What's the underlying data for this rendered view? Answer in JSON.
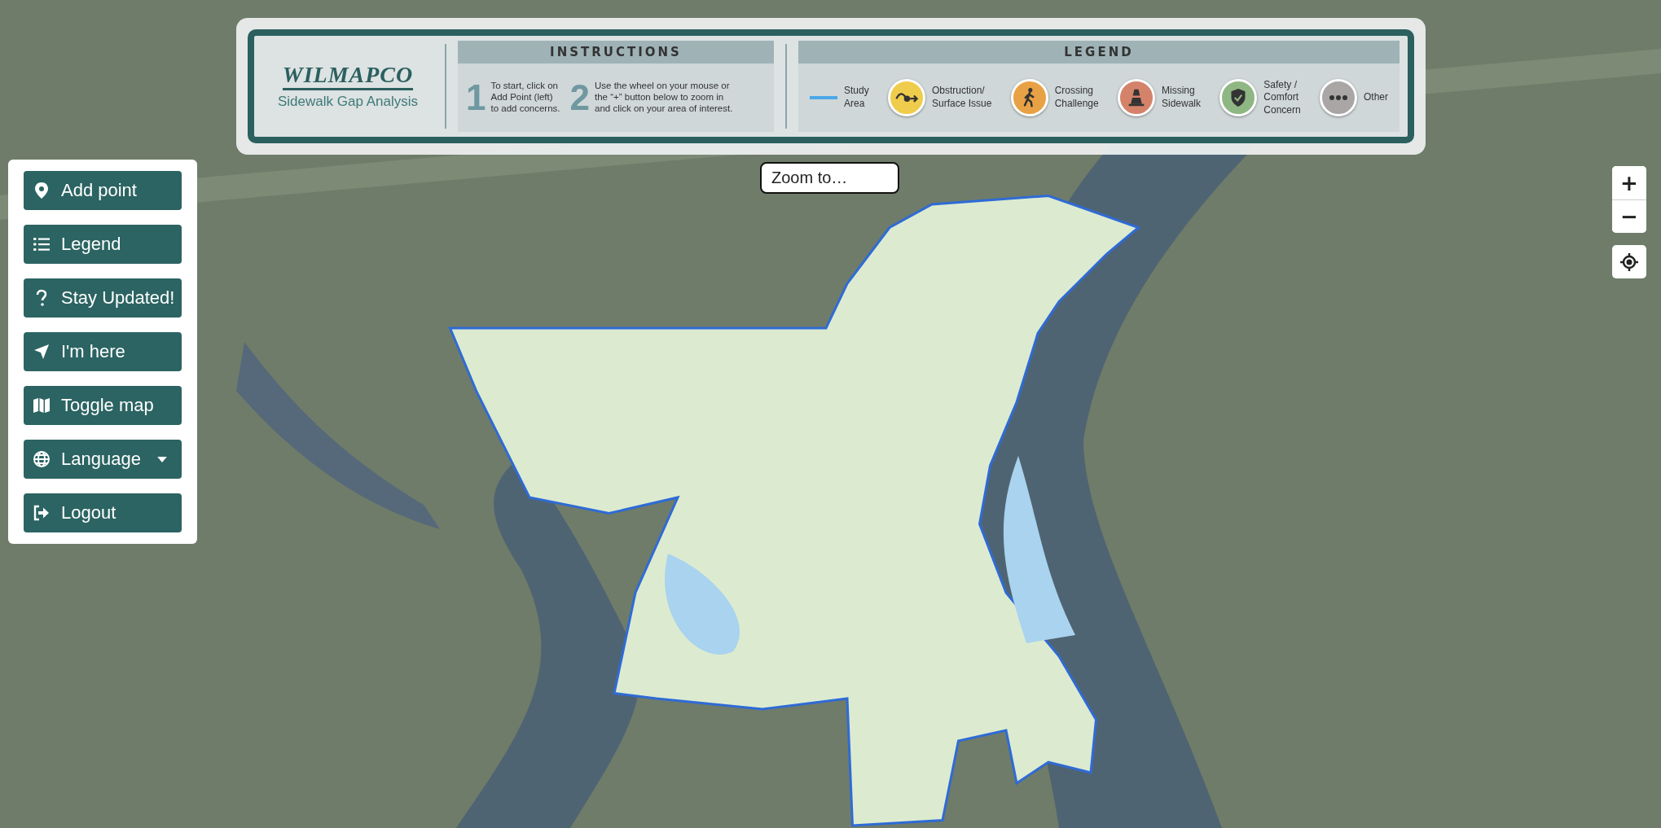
{
  "header": {
    "logo": "WILMAPCO",
    "subtitle": "Sidewalk Gap Analysis",
    "instructions": {
      "title": "INSTRUCTIONS",
      "steps": [
        {
          "number": "1",
          "text": "To start, click on\nAdd Point (left)\nto add concerns."
        },
        {
          "number": "2",
          "text": "Use the wheel on your mouse or\nthe “+” button below to zoom in\nand click on your area of interest."
        }
      ]
    },
    "legend": {
      "title": "LEGEND",
      "items": [
        {
          "kind": "line",
          "color": "#4aa8e8",
          "label": "Study\nArea"
        },
        {
          "kind": "obstruction",
          "color": "#f0cc4c",
          "label": "Obstruction/\nSurface Issue"
        },
        {
          "kind": "crossing",
          "color": "#e8a144",
          "label": "Crossing\nChallenge"
        },
        {
          "kind": "cone",
          "color": "#d4826a",
          "label": "Missing\nSidewalk"
        },
        {
          "kind": "shield",
          "color": "#8fb784",
          "label": "Safety /\nComfort\nConcern"
        },
        {
          "kind": "dots",
          "color": "#aaa6a6",
          "label": "Other"
        }
      ]
    }
  },
  "menu": [
    {
      "kind": "pin",
      "label": "Add point"
    },
    {
      "kind": "list",
      "label": "Legend"
    },
    {
      "kind": "question",
      "label": "Stay Updated!"
    },
    {
      "kind": "arrow",
      "label": "I'm here"
    },
    {
      "kind": "map",
      "label": "Toggle map"
    },
    {
      "kind": "globe",
      "label": "Language",
      "dropdown": true
    },
    {
      "kind": "logout",
      "label": "Logout"
    }
  ],
  "zoom_field": {
    "placeholder": "Zoom to…"
  },
  "zoom_controls": {
    "zoom_in": "+",
    "zoom_out": "−"
  }
}
